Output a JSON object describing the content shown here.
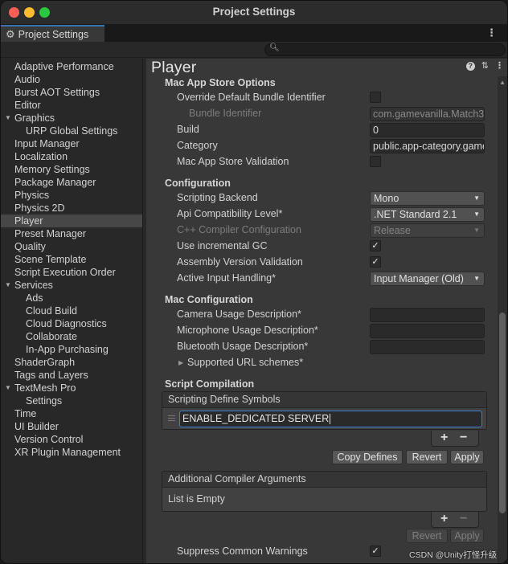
{
  "window": {
    "title": "Project Settings"
  },
  "tab": {
    "label": "Project Settings",
    "icon": "gear-icon"
  },
  "search": {
    "value": ""
  },
  "sidebar": {
    "items": [
      {
        "label": "Adaptive Performance",
        "level": 1
      },
      {
        "label": "Audio",
        "level": 1
      },
      {
        "label": "Burst AOT Settings",
        "level": 1
      },
      {
        "label": "Editor",
        "level": 1
      },
      {
        "label": "Graphics",
        "level": 1,
        "expanded": true
      },
      {
        "label": "URP Global Settings",
        "level": 2
      },
      {
        "label": "Input Manager",
        "level": 1
      },
      {
        "label": "Localization",
        "level": 1
      },
      {
        "label": "Memory Settings",
        "level": 1
      },
      {
        "label": "Package Manager",
        "level": 1
      },
      {
        "label": "Physics",
        "level": 1
      },
      {
        "label": "Physics 2D",
        "level": 1
      },
      {
        "label": "Player",
        "level": 1,
        "selected": true
      },
      {
        "label": "Preset Manager",
        "level": 1
      },
      {
        "label": "Quality",
        "level": 1
      },
      {
        "label": "Scene Template",
        "level": 1
      },
      {
        "label": "Script Execution Order",
        "level": 1
      },
      {
        "label": "Services",
        "level": 1,
        "expanded": true
      },
      {
        "label": "Ads",
        "level": 2
      },
      {
        "label": "Cloud Build",
        "level": 2
      },
      {
        "label": "Cloud Diagnostics",
        "level": 2
      },
      {
        "label": "Collaborate",
        "level": 2
      },
      {
        "label": "In-App Purchasing",
        "level": 2
      },
      {
        "label": "ShaderGraph",
        "level": 1
      },
      {
        "label": "Tags and Layers",
        "level": 1
      },
      {
        "label": "TextMesh Pro",
        "level": 1,
        "expanded": true
      },
      {
        "label": "Settings",
        "level": 2
      },
      {
        "label": "Time",
        "level": 1
      },
      {
        "label": "UI Builder",
        "level": 1
      },
      {
        "label": "Version Control",
        "level": 1
      },
      {
        "label": "XR Plugin Management",
        "level": 1
      }
    ]
  },
  "main": {
    "title": "Player",
    "mac_app_store": {
      "heading": "Mac App Store Options",
      "override_label": "Override Default Bundle Identifier",
      "override_checked": false,
      "bundle_id_label": "Bundle Identifier",
      "bundle_id_value": "com.gamevanilla.Match3",
      "build_label": "Build",
      "build_value": "0",
      "category_label": "Category",
      "category_value": "public.app-category.games",
      "validation_label": "Mac App Store Validation",
      "validation_checked": false
    },
    "configuration": {
      "heading": "Configuration",
      "scripting_backend_label": "Scripting Backend",
      "scripting_backend_value": "Mono",
      "api_label": "Api Compatibility Level*",
      "api_value": ".NET Standard 2.1",
      "cpp_label": "C++ Compiler Configuration",
      "cpp_value": "Release",
      "incremental_gc_label": "Use incremental GC",
      "incremental_gc_checked": true,
      "assembly_label": "Assembly Version Validation",
      "assembly_checked": true,
      "input_label": "Active Input Handling*",
      "input_value": "Input Manager (Old)"
    },
    "mac_config": {
      "heading": "Mac Configuration",
      "camera_label": "Camera Usage Description*",
      "camera_value": "",
      "mic_label": "Microphone Usage Description*",
      "mic_value": "",
      "bluetooth_label": "Bluetooth Usage Description*",
      "bluetooth_value": "",
      "url_schemes_label": "Supported URL schemes*"
    },
    "script_compilation": {
      "heading": "Script Compilation",
      "defines_header": "Scripting Define Symbols",
      "defines": [
        "ENABLE_DEDICATED SERVER"
      ],
      "add_label": "+",
      "remove_label": "−",
      "copy_defines_label": "Copy Defines",
      "revert_label": "Revert",
      "apply_label": "Apply",
      "compiler_args_header": "Additional Compiler Arguments",
      "compiler_args_empty": "List is Empty",
      "suppress_label": "Suppress Common Warnings",
      "suppress_checked": true
    }
  },
  "watermark": "CSDN @Unity打怪升级"
}
